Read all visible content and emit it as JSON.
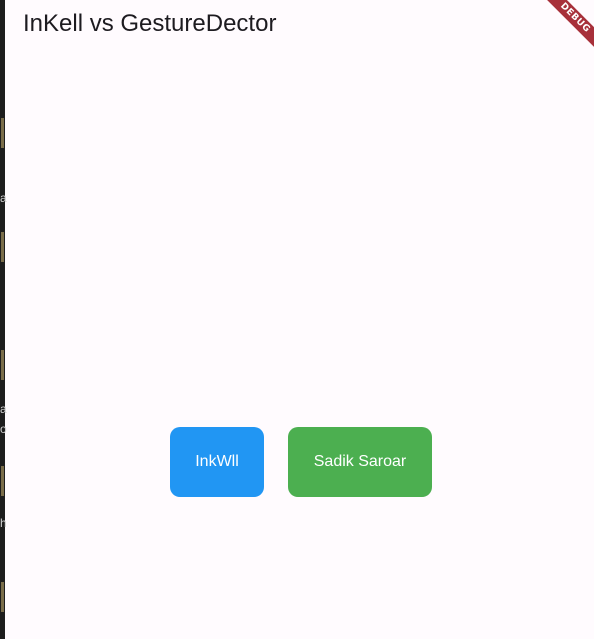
{
  "app_bar": {
    "title": "InKell vs GestureDector"
  },
  "debug_banner": {
    "label": "DEBUG",
    "color": "#a7303a"
  },
  "buttons": {
    "inkwell": {
      "label": "InkWll",
      "color": "#2196f3"
    },
    "gesture": {
      "label": "Sadik Saroar",
      "color": "#4caf50"
    }
  },
  "background_window": {
    "fragments": [
      "a",
      "a",
      "o",
      "h"
    ]
  }
}
